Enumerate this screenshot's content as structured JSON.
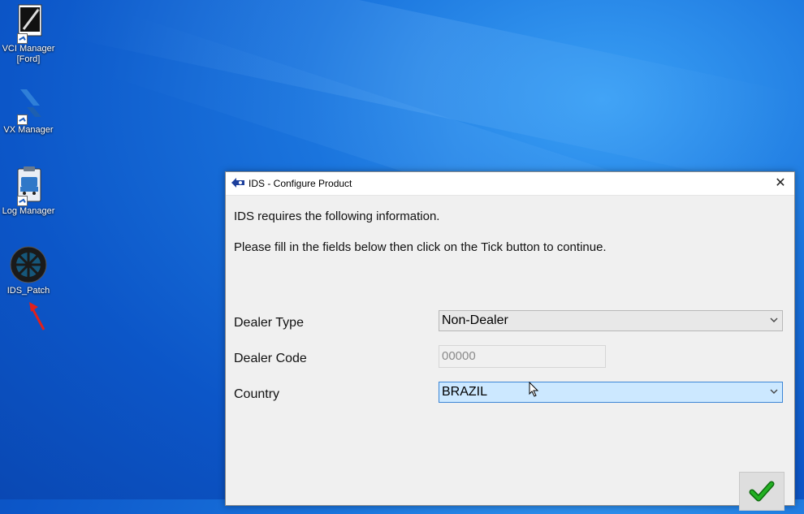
{
  "desktop": {
    "icons": [
      {
        "label": "VCI Manager\n[Ford]",
        "icon": "vci-manager-icon"
      },
      {
        "label": "VX Manager",
        "icon": "vx-manager-icon"
      },
      {
        "label": "Log Manager",
        "icon": "log-manager-icon"
      },
      {
        "label": "IDS_Patch",
        "icon": "ids-patch-wheel-icon"
      }
    ]
  },
  "dialog": {
    "title": "IDS - Configure Product",
    "intro": "IDS requires the following information.",
    "instructions": "Please fill in the fields below then click on the Tick button to continue.",
    "fields": {
      "dealer_type": {
        "label": "Dealer Type",
        "value": "Non-Dealer"
      },
      "dealer_code": {
        "label": "Dealer Code",
        "placeholder": "00000"
      },
      "country": {
        "label": "Country",
        "value": "BRAZIL"
      }
    }
  },
  "colors": {
    "accent_blue": "#0c56c8",
    "active_field": "#cce8ff",
    "tick_green": "#1e9b1e"
  }
}
